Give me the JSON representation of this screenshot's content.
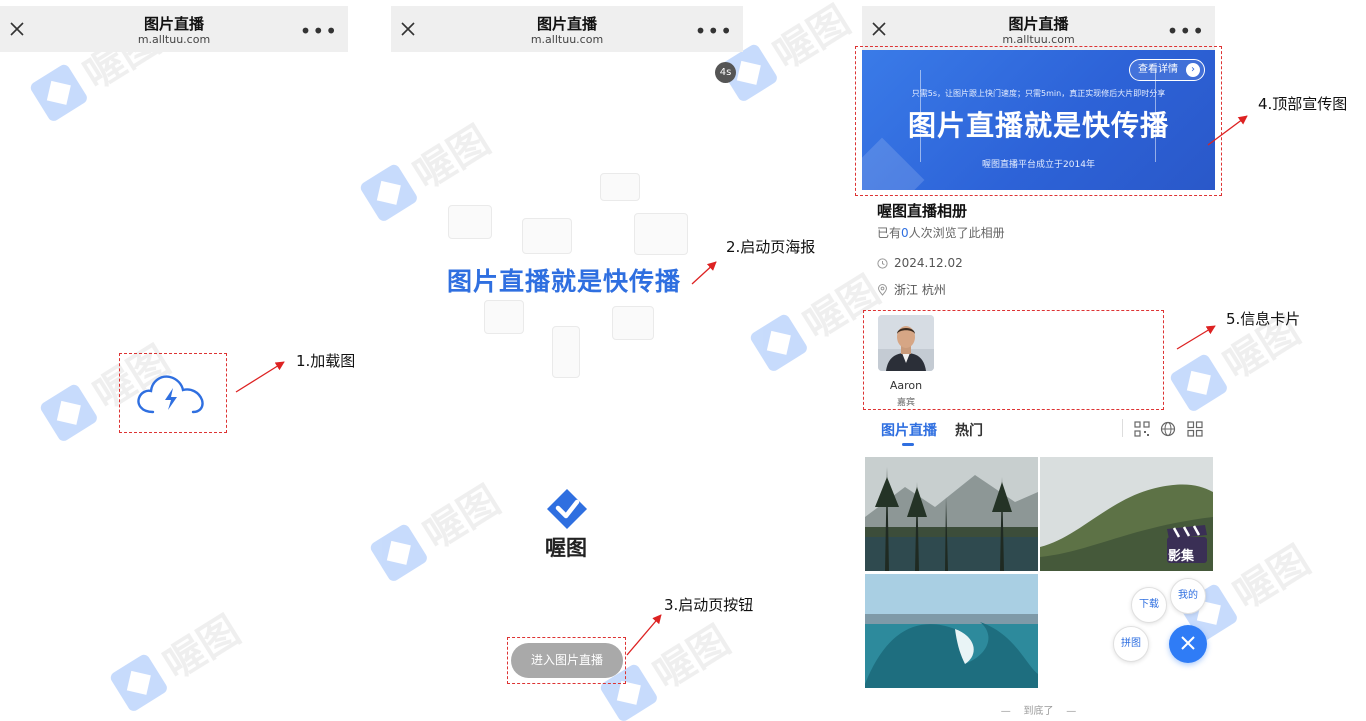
{
  "watermark": {
    "text": "喔图"
  },
  "panels": [
    {
      "nav": {
        "title": "图片直播",
        "url": "m.alltuu.com"
      }
    },
    {
      "nav": {
        "title": "图片直播",
        "url": "m.alltuu.com"
      }
    },
    {
      "nav": {
        "title": "图片直播",
        "url": "m.alltuu.com"
      }
    }
  ],
  "loading": {
    "icon": "cloud-lightning-icon"
  },
  "splash": {
    "timer": "4s",
    "poster_title": "图片直播就是快传播",
    "brand_name": "喔图",
    "enter_button": "进入图片直播"
  },
  "album": {
    "banner": {
      "subtitle": "只需5s，让图片跟上快门速度；只需5min，真正实现修后大片即时分享",
      "title": "图片直播就是快传播",
      "footer": "喔图直播平台成立于2014年",
      "detail_button": "查看详情"
    },
    "title": "喔图直播相册",
    "views_prefix": "已有",
    "views_count": "0",
    "views_suffix": "人次浏览了此相册",
    "date": "2024.12.02",
    "location": "浙江 杭州",
    "guest": {
      "name": "Aaron",
      "role": "嘉宾"
    },
    "tabs": [
      {
        "label": "图片直播",
        "active": true
      },
      {
        "label": "热门",
        "active": false
      }
    ],
    "tools": [
      "qrcode-icon",
      "globe-icon",
      "grid-icon"
    ],
    "film_badge": "影集",
    "fab": {
      "download": "下载",
      "mine": "我的",
      "puzzle": "拼图"
    },
    "end_text": "到底了"
  },
  "annotations": {
    "a1": "1.加载图",
    "a2": "2.启动页海报",
    "a3": "3.启动页按钮",
    "a4": "4.顶部宣传图",
    "a5": "5.信息卡片"
  },
  "colors": {
    "accent": "#2f6fe0",
    "annotation": "#dd2222",
    "navbar": "#efefef"
  }
}
